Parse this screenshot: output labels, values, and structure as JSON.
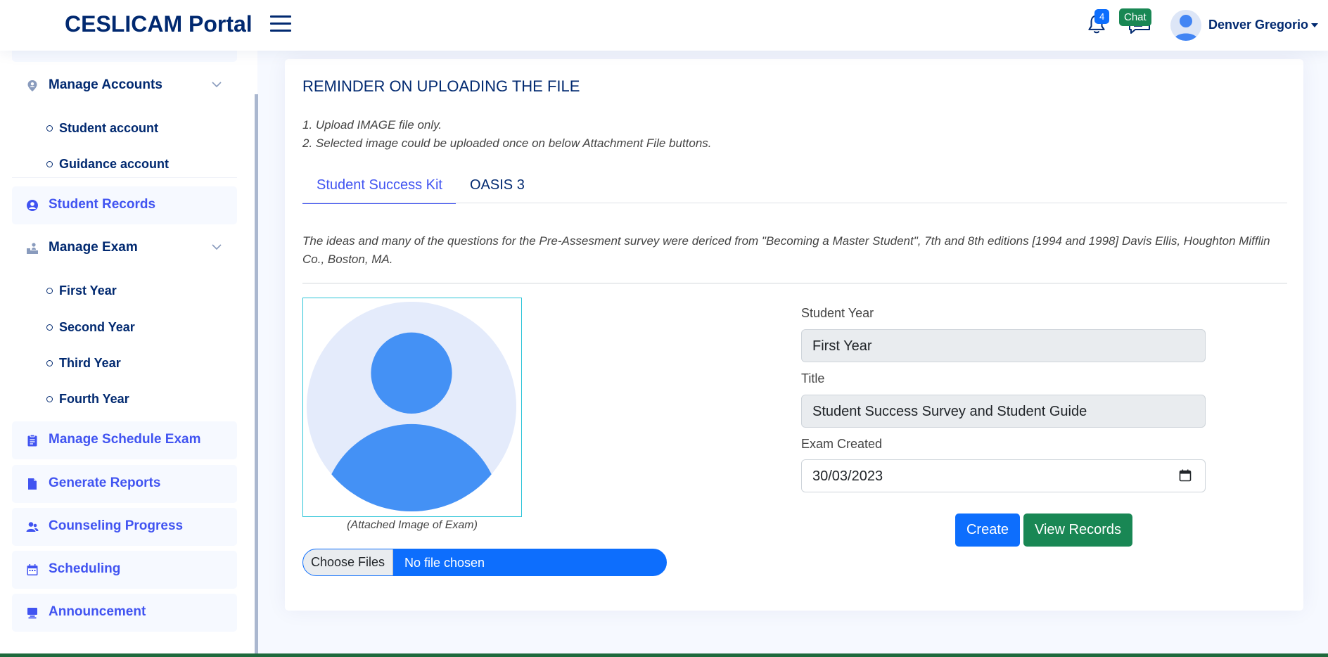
{
  "header": {
    "brand": "CESLICAM Portal",
    "notification_count": "4",
    "chat_badge": "Chat",
    "user_name": "Denver Gregorio"
  },
  "sidebar": {
    "manage_accounts": "Manage Accounts",
    "accounts_sub": [
      "Student account",
      "Guidance account"
    ],
    "student_records": "Student Records",
    "manage_exam": "Manage Exam",
    "exam_sub": [
      "First Year",
      "Second Year",
      "Third Year",
      "Fourth Year"
    ],
    "manage_schedule_exam": "Manage Schedule Exam",
    "generate_reports": "Generate Reports",
    "counseling_progress": "Counseling Progress",
    "scheduling": "Scheduling",
    "announcement": "Announcement"
  },
  "main": {
    "title": "REMINDER ON UPLOADING THE FILE",
    "reminders": [
      "1. Upload IMAGE file only.",
      "2. Selected image could be uploaded once on below Attachment File buttons."
    ],
    "tabs": [
      "Student Success Kit",
      "OASIS 3"
    ],
    "intro": "The ideas and many of the questions for the Pre-Assesment survey were dericed from \"Becoming a Master Student\", 7th and 8th editions [1994 and 1998] Davis Ellis, Houghton Mifflin Co., Boston, MA.",
    "image_caption": "(Attached Image of Exam)",
    "file_button": "Choose Files",
    "file_status": "No file chosen",
    "form": {
      "student_year_label": "Student Year",
      "student_year_value": "First Year",
      "title_label": "Title",
      "title_value": "Student Success Survey and Student Guide",
      "exam_created_label": "Exam Created",
      "exam_created_value": "30/03/2023"
    },
    "create_button": "Create",
    "view_records_button": "View Records"
  },
  "colors": {
    "navy": "#012970",
    "accent": "#4154f1",
    "primary": "#0d6efd",
    "success": "#198754"
  },
  "icons": [
    "bell-icon",
    "chat-icon",
    "menu-icon",
    "user-avatar",
    "chevron-down-icon",
    "calendar-icon"
  ]
}
